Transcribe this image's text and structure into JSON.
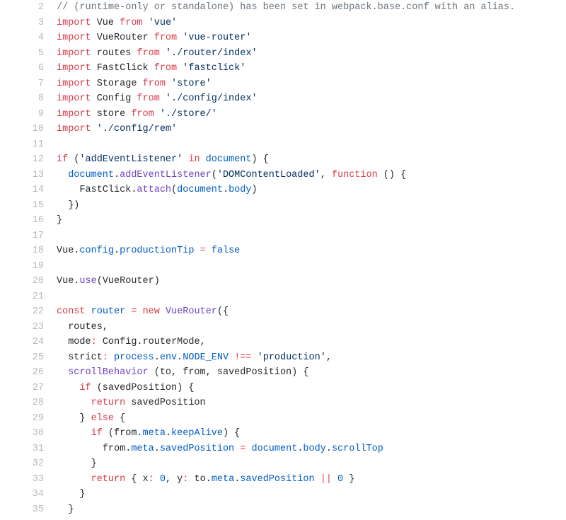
{
  "editor": {
    "line_numbers": [
      "2",
      "3",
      "4",
      "5",
      "6",
      "7",
      "8",
      "9",
      "10",
      "11",
      "12",
      "13",
      "14",
      "15",
      "16",
      "17",
      "18",
      "19",
      "20",
      "21",
      "22",
      "23",
      "24",
      "25",
      "26",
      "27",
      "28",
      "29",
      "30",
      "31",
      "32",
      "33",
      "34",
      "35"
    ],
    "lines": [
      {
        "indent": 0,
        "tokens": [
          {
            "cls": "tok-cm",
            "t": "// (runtime-only or standalone) has been set in webpack.base.conf with an alias."
          }
        ]
      },
      {
        "indent": 0,
        "tokens": [
          {
            "cls": "tok-kw",
            "t": "import"
          },
          {
            "cls": "tok-nm",
            "t": " Vue "
          },
          {
            "cls": "tok-kw",
            "t": "from"
          },
          {
            "cls": "tok-nm",
            "t": " "
          },
          {
            "cls": "tok-st",
            "t": "'vue'"
          }
        ]
      },
      {
        "indent": 0,
        "tokens": [
          {
            "cls": "tok-kw",
            "t": "import"
          },
          {
            "cls": "tok-nm",
            "t": " VueRouter "
          },
          {
            "cls": "tok-kw",
            "t": "from"
          },
          {
            "cls": "tok-nm",
            "t": " "
          },
          {
            "cls": "tok-st",
            "t": "'vue-router'"
          }
        ]
      },
      {
        "indent": 0,
        "tokens": [
          {
            "cls": "tok-kw",
            "t": "import"
          },
          {
            "cls": "tok-nm",
            "t": " routes "
          },
          {
            "cls": "tok-kw",
            "t": "from"
          },
          {
            "cls": "tok-nm",
            "t": " "
          },
          {
            "cls": "tok-st",
            "t": "'./router/index'"
          }
        ]
      },
      {
        "indent": 0,
        "tokens": [
          {
            "cls": "tok-kw",
            "t": "import"
          },
          {
            "cls": "tok-nm",
            "t": " FastClick "
          },
          {
            "cls": "tok-kw",
            "t": "from"
          },
          {
            "cls": "tok-nm",
            "t": " "
          },
          {
            "cls": "tok-st",
            "t": "'fastclick'"
          }
        ]
      },
      {
        "indent": 0,
        "tokens": [
          {
            "cls": "tok-kw",
            "t": "import"
          },
          {
            "cls": "tok-nm",
            "t": " Storage "
          },
          {
            "cls": "tok-kw",
            "t": "from"
          },
          {
            "cls": "tok-nm",
            "t": " "
          },
          {
            "cls": "tok-st",
            "t": "'store'"
          }
        ]
      },
      {
        "indent": 0,
        "tokens": [
          {
            "cls": "tok-kw",
            "t": "import"
          },
          {
            "cls": "tok-nm",
            "t": " Config "
          },
          {
            "cls": "tok-kw",
            "t": "from"
          },
          {
            "cls": "tok-nm",
            "t": " "
          },
          {
            "cls": "tok-st",
            "t": "'./config/index'"
          }
        ]
      },
      {
        "indent": 0,
        "tokens": [
          {
            "cls": "tok-kw",
            "t": "import"
          },
          {
            "cls": "tok-nm",
            "t": " store "
          },
          {
            "cls": "tok-kw",
            "t": "from"
          },
          {
            "cls": "tok-nm",
            "t": " "
          },
          {
            "cls": "tok-st",
            "t": "'./store/'"
          }
        ]
      },
      {
        "indent": 0,
        "tokens": [
          {
            "cls": "tok-kw",
            "t": "import"
          },
          {
            "cls": "tok-nm",
            "t": " "
          },
          {
            "cls": "tok-st",
            "t": "'./config/rem'"
          }
        ]
      },
      {
        "indent": 0,
        "tokens": []
      },
      {
        "indent": 0,
        "tokens": [
          {
            "cls": "tok-kw",
            "t": "if"
          },
          {
            "cls": "tok-nm",
            "t": " ("
          },
          {
            "cls": "tok-st",
            "t": "'addEventListener'"
          },
          {
            "cls": "tok-nm",
            "t": " "
          },
          {
            "cls": "tok-kw",
            "t": "in"
          },
          {
            "cls": "tok-nm",
            "t": " "
          },
          {
            "cls": "tok-va",
            "t": "document"
          },
          {
            "cls": "tok-nm",
            "t": ") {"
          }
        ]
      },
      {
        "indent": 1,
        "tokens": [
          {
            "cls": "tok-va",
            "t": "document"
          },
          {
            "cls": "tok-nm",
            "t": "."
          },
          {
            "cls": "tok-fn",
            "t": "addEventListener"
          },
          {
            "cls": "tok-nm",
            "t": "("
          },
          {
            "cls": "tok-st",
            "t": "'DOMContentLoaded'"
          },
          {
            "cls": "tok-nm",
            "t": ", "
          },
          {
            "cls": "tok-kw",
            "t": "function"
          },
          {
            "cls": "tok-nm",
            "t": " () {"
          }
        ]
      },
      {
        "indent": 2,
        "tokens": [
          {
            "cls": "tok-nm",
            "t": "FastClick."
          },
          {
            "cls": "tok-fn",
            "t": "attach"
          },
          {
            "cls": "tok-nm",
            "t": "("
          },
          {
            "cls": "tok-va",
            "t": "document"
          },
          {
            "cls": "tok-nm",
            "t": "."
          },
          {
            "cls": "tok-va",
            "t": "body"
          },
          {
            "cls": "tok-nm",
            "t": ")"
          }
        ]
      },
      {
        "indent": 1,
        "tokens": [
          {
            "cls": "tok-nm",
            "t": "})"
          }
        ]
      },
      {
        "indent": 0,
        "tokens": [
          {
            "cls": "tok-nm",
            "t": "}"
          }
        ]
      },
      {
        "indent": 0,
        "tokens": []
      },
      {
        "indent": 0,
        "tokens": [
          {
            "cls": "tok-nm",
            "t": "Vue."
          },
          {
            "cls": "tok-va",
            "t": "config"
          },
          {
            "cls": "tok-nm",
            "t": "."
          },
          {
            "cls": "tok-va",
            "t": "productionTip"
          },
          {
            "cls": "tok-nm",
            "t": " "
          },
          {
            "cls": "tok-kw",
            "t": "="
          },
          {
            "cls": "tok-nm",
            "t": " "
          },
          {
            "cls": "tok-va",
            "t": "false"
          }
        ]
      },
      {
        "indent": 0,
        "tokens": []
      },
      {
        "indent": 0,
        "tokens": [
          {
            "cls": "tok-nm",
            "t": "Vue."
          },
          {
            "cls": "tok-fn",
            "t": "use"
          },
          {
            "cls": "tok-nm",
            "t": "(VueRouter)"
          }
        ]
      },
      {
        "indent": 0,
        "tokens": []
      },
      {
        "indent": 0,
        "tokens": [
          {
            "cls": "tok-kw",
            "t": "const"
          },
          {
            "cls": "tok-nm",
            "t": " "
          },
          {
            "cls": "tok-va",
            "t": "router"
          },
          {
            "cls": "tok-nm",
            "t": " "
          },
          {
            "cls": "tok-kw",
            "t": "="
          },
          {
            "cls": "tok-nm",
            "t": " "
          },
          {
            "cls": "tok-kw",
            "t": "new"
          },
          {
            "cls": "tok-nm",
            "t": " "
          },
          {
            "cls": "tok-fn",
            "t": "VueRouter"
          },
          {
            "cls": "tok-nm",
            "t": "({"
          }
        ]
      },
      {
        "indent": 1,
        "tokens": [
          {
            "cls": "tok-nm",
            "t": "routes,"
          }
        ]
      },
      {
        "indent": 1,
        "tokens": [
          {
            "cls": "tok-nm",
            "t": "mode"
          },
          {
            "cls": "tok-kw",
            "t": ":"
          },
          {
            "cls": "tok-nm",
            "t": " Config.routerMode,"
          }
        ]
      },
      {
        "indent": 1,
        "tokens": [
          {
            "cls": "tok-nm",
            "t": "strict"
          },
          {
            "cls": "tok-kw",
            "t": ":"
          },
          {
            "cls": "tok-nm",
            "t": " "
          },
          {
            "cls": "tok-va",
            "t": "process"
          },
          {
            "cls": "tok-nm",
            "t": "."
          },
          {
            "cls": "tok-va",
            "t": "env"
          },
          {
            "cls": "tok-nm",
            "t": "."
          },
          {
            "cls": "tok-va",
            "t": "NODE_ENV"
          },
          {
            "cls": "tok-nm",
            "t": " "
          },
          {
            "cls": "tok-kw",
            "t": "!=="
          },
          {
            "cls": "tok-nm",
            "t": " "
          },
          {
            "cls": "tok-st",
            "t": "'production'"
          },
          {
            "cls": "tok-nm",
            "t": ","
          }
        ]
      },
      {
        "indent": 1,
        "tokens": [
          {
            "cls": "tok-fn",
            "t": "scrollBehavior"
          },
          {
            "cls": "tok-nm",
            "t": " (to, from, savedPosition) {"
          }
        ]
      },
      {
        "indent": 2,
        "tokens": [
          {
            "cls": "tok-kw",
            "t": "if"
          },
          {
            "cls": "tok-nm",
            "t": " (savedPosition) {"
          }
        ]
      },
      {
        "indent": 3,
        "tokens": [
          {
            "cls": "tok-kw",
            "t": "return"
          },
          {
            "cls": "tok-nm",
            "t": " savedPosition"
          }
        ]
      },
      {
        "indent": 2,
        "tokens": [
          {
            "cls": "tok-nm",
            "t": "} "
          },
          {
            "cls": "tok-kw",
            "t": "else"
          },
          {
            "cls": "tok-nm",
            "t": " {"
          }
        ]
      },
      {
        "indent": 3,
        "tokens": [
          {
            "cls": "tok-kw",
            "t": "if"
          },
          {
            "cls": "tok-nm",
            "t": " (from."
          },
          {
            "cls": "tok-va",
            "t": "meta"
          },
          {
            "cls": "tok-nm",
            "t": "."
          },
          {
            "cls": "tok-va",
            "t": "keepAlive"
          },
          {
            "cls": "tok-nm",
            "t": ") {"
          }
        ]
      },
      {
        "indent": 4,
        "tokens": [
          {
            "cls": "tok-nm",
            "t": "from."
          },
          {
            "cls": "tok-va",
            "t": "meta"
          },
          {
            "cls": "tok-nm",
            "t": "."
          },
          {
            "cls": "tok-va",
            "t": "savedPosition"
          },
          {
            "cls": "tok-nm",
            "t": " "
          },
          {
            "cls": "tok-kw",
            "t": "="
          },
          {
            "cls": "tok-nm",
            "t": " "
          },
          {
            "cls": "tok-va",
            "t": "document"
          },
          {
            "cls": "tok-nm",
            "t": "."
          },
          {
            "cls": "tok-va",
            "t": "body"
          },
          {
            "cls": "tok-nm",
            "t": "."
          },
          {
            "cls": "tok-va",
            "t": "scrollTop"
          }
        ]
      },
      {
        "indent": 3,
        "tokens": [
          {
            "cls": "tok-nm",
            "t": "}"
          }
        ]
      },
      {
        "indent": 3,
        "tokens": [
          {
            "cls": "tok-kw",
            "t": "return"
          },
          {
            "cls": "tok-nm",
            "t": " { x"
          },
          {
            "cls": "tok-kw",
            "t": ":"
          },
          {
            "cls": "tok-nm",
            "t": " "
          },
          {
            "cls": "tok-va",
            "t": "0"
          },
          {
            "cls": "tok-nm",
            "t": ", y"
          },
          {
            "cls": "tok-kw",
            "t": ":"
          },
          {
            "cls": "tok-nm",
            "t": " to."
          },
          {
            "cls": "tok-va",
            "t": "meta"
          },
          {
            "cls": "tok-nm",
            "t": "."
          },
          {
            "cls": "tok-va",
            "t": "savedPosition"
          },
          {
            "cls": "tok-nm",
            "t": " "
          },
          {
            "cls": "tok-kw",
            "t": "||"
          },
          {
            "cls": "tok-nm",
            "t": " "
          },
          {
            "cls": "tok-va",
            "t": "0"
          },
          {
            "cls": "tok-nm",
            "t": " }"
          }
        ]
      },
      {
        "indent": 2,
        "tokens": [
          {
            "cls": "tok-nm",
            "t": "}"
          }
        ]
      },
      {
        "indent": 1,
        "tokens": [
          {
            "cls": "tok-nm",
            "t": "}"
          }
        ]
      }
    ]
  }
}
